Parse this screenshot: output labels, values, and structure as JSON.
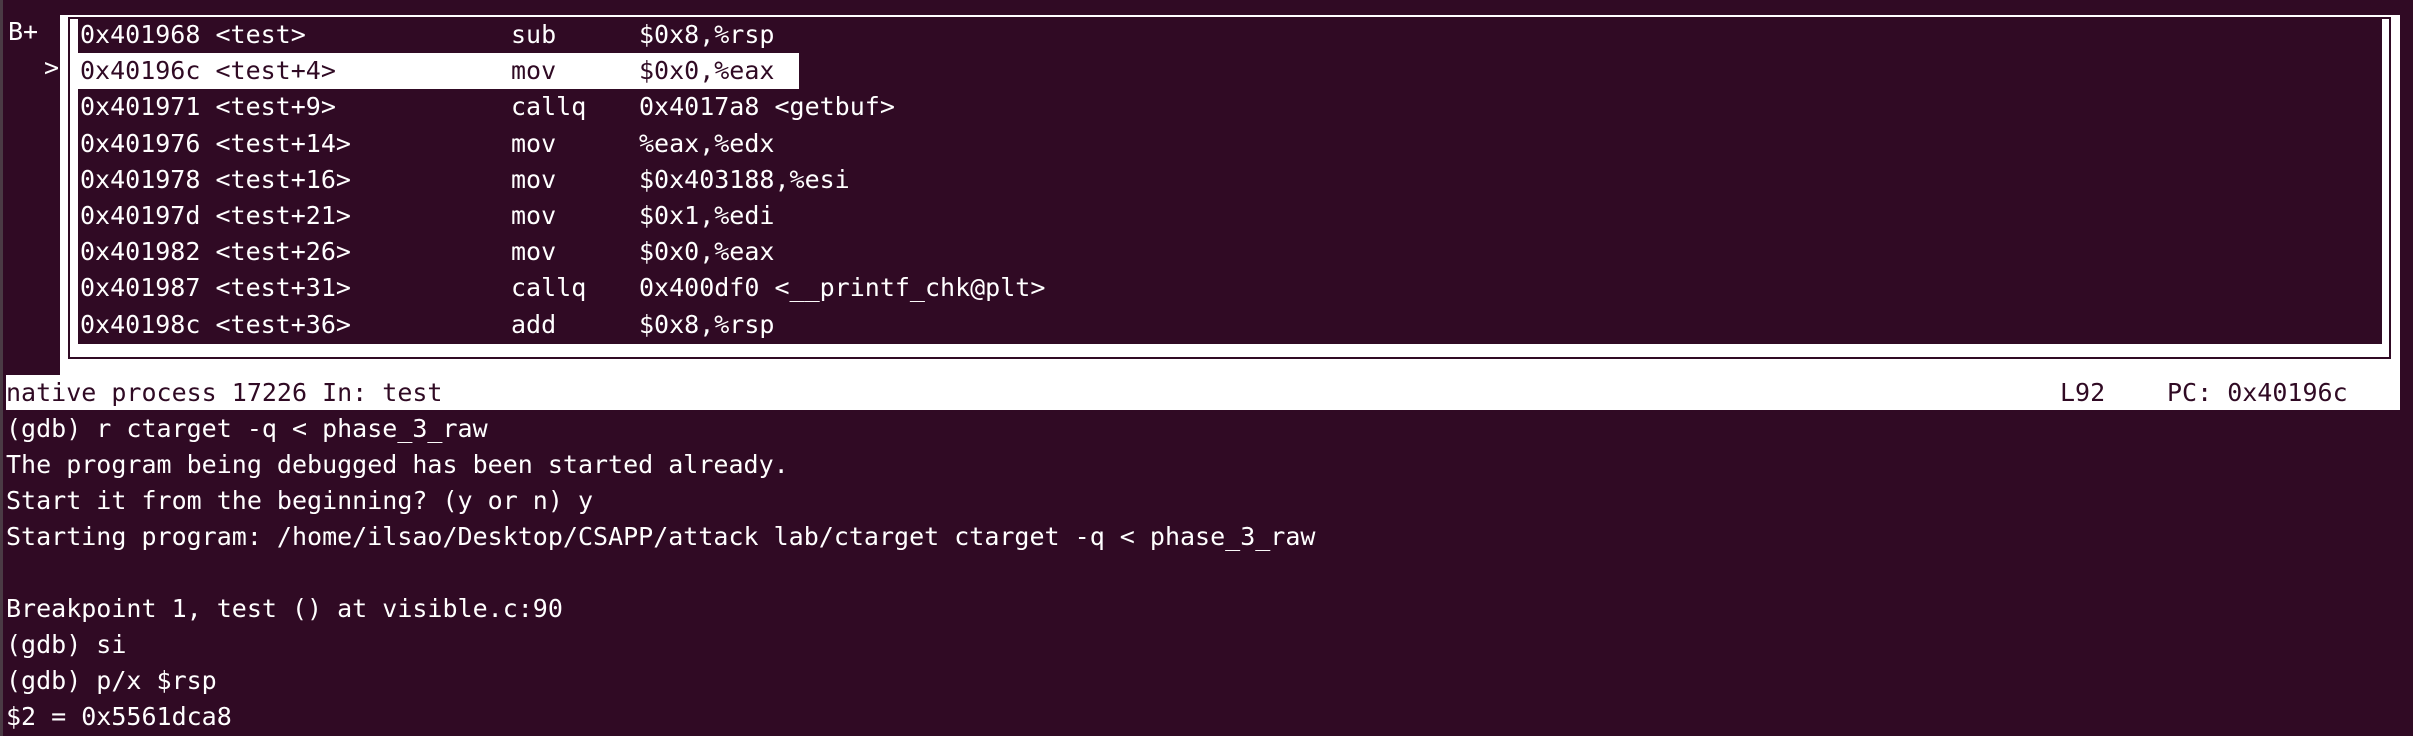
{
  "colors": {
    "background": "#300a24",
    "text": "#ffffff",
    "highlight": "#ffffff"
  },
  "gutter": {
    "breakpoint_marker": "B+",
    "current_marker": ">"
  },
  "asm": [
    {
      "addr": "0x401968 <test>",
      "mnemonic": "sub",
      "operands": "$0x8,%rsp"
    },
    {
      "addr": "0x40196c <test+4>",
      "mnemonic": "mov",
      "operands": "$0x0,%eax",
      "current": true
    },
    {
      "addr": "0x401971 <test+9>",
      "mnemonic": "callq",
      "operands": "0x4017a8 <getbuf>"
    },
    {
      "addr": "0x401976 <test+14>",
      "mnemonic": "mov",
      "operands": "%eax,%edx"
    },
    {
      "addr": "0x401978 <test+16>",
      "mnemonic": "mov",
      "operands": "$0x403188,%esi"
    },
    {
      "addr": "0x40197d <test+21>",
      "mnemonic": "mov",
      "operands": "$0x1,%edi"
    },
    {
      "addr": "0x401982 <test+26>",
      "mnemonic": "mov",
      "operands": "$0x0,%eax"
    },
    {
      "addr": "0x401987 <test+31>",
      "mnemonic": "callq",
      "operands": "0x400df0 <__printf_chk@plt>"
    },
    {
      "addr": "0x40198c <test+36>",
      "mnemonic": "add",
      "operands": "$0x8,%rsp"
    }
  ],
  "status": {
    "process": "native process 17226 In: test",
    "line": "L92",
    "pc": "PC: 0x40196c"
  },
  "console": [
    "(gdb) r ctarget -q < phase_3_raw",
    "The program being debugged has been started already.",
    "Start it from the beginning? (y or n) y",
    "Starting program: /home/ilsao/Desktop/CSAPP/attack lab/ctarget ctarget -q < phase_3_raw",
    "",
    "Breakpoint 1, test () at visible.c:90",
    "(gdb) si",
    "(gdb) p/x $rsp",
    "$2 = 0x5561dca8"
  ]
}
